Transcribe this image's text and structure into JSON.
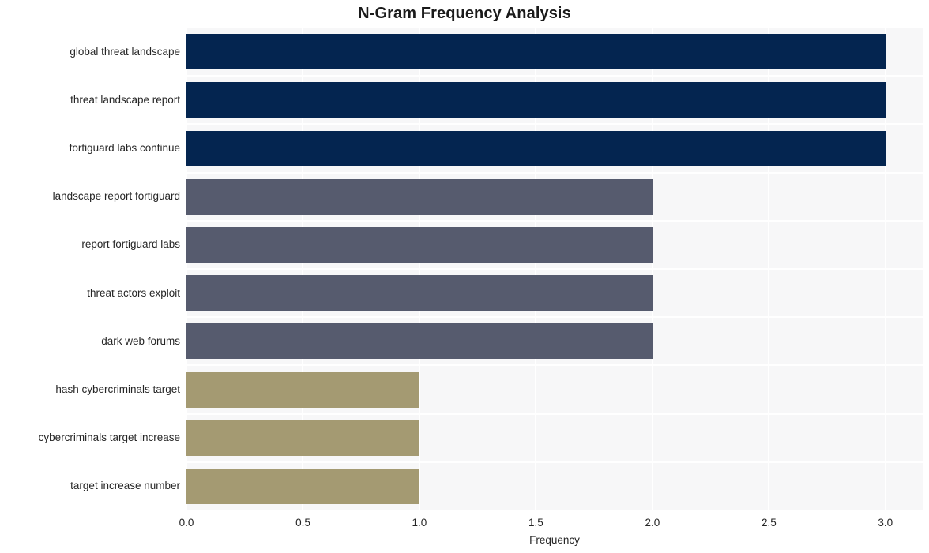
{
  "chart_data": {
    "type": "bar",
    "orientation": "horizontal",
    "title": "N-Gram Frequency Analysis",
    "xlabel": "Frequency",
    "ylabel": "",
    "xlim": [
      0.0,
      3.16
    ],
    "xticks": [
      "0.0",
      "0.5",
      "1.0",
      "1.5",
      "2.0",
      "2.5",
      "3.0"
    ],
    "xtick_values": [
      0.0,
      0.5,
      1.0,
      1.5,
      2.0,
      2.5,
      3.0
    ],
    "grid": true,
    "grid_color": "#ffffff",
    "plot_background": "#f7f7f8",
    "figure_background": "#ffffff",
    "legend": null,
    "categories": [
      "global threat landscape",
      "threat landscape report",
      "fortiguard labs continue",
      "landscape report fortiguard",
      "report fortiguard labs",
      "threat actors exploit",
      "dark web forums",
      "hash cybercriminals target",
      "cybercriminals target increase",
      "target increase number"
    ],
    "values": [
      3,
      3,
      3,
      2,
      2,
      2,
      2,
      1,
      1,
      1
    ],
    "bar_colors": [
      "#042550",
      "#042550",
      "#042550",
      "#565b6e",
      "#565b6e",
      "#565b6e",
      "#565b6e",
      "#a49a72",
      "#a49a72",
      "#a49a72"
    ],
    "palette": {
      "high": "#042550",
      "mid": "#565b6e",
      "low": "#a49a72"
    }
  }
}
